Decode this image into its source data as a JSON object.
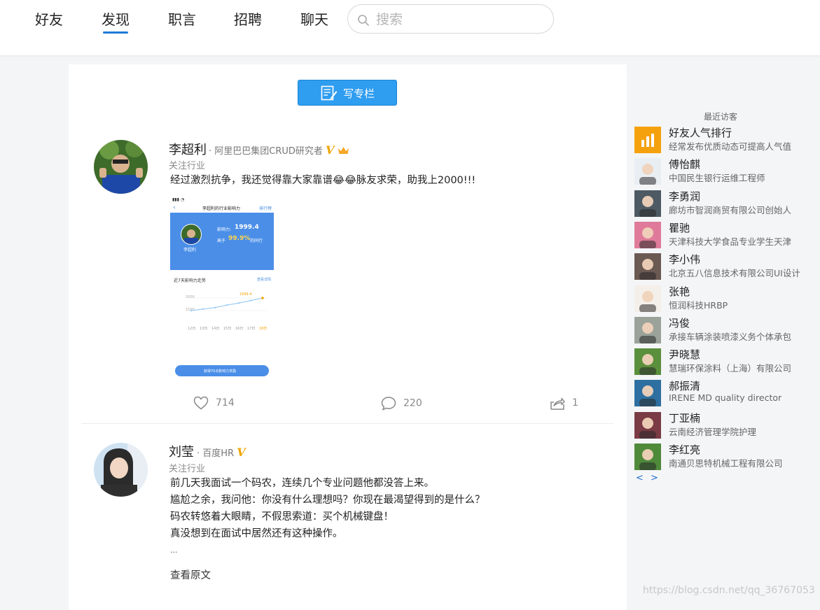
{
  "nav": {
    "items": [
      "好友",
      "发现",
      "职言",
      "招聘",
      "聊天"
    ],
    "active_index": 1,
    "accent_color": "#1e7bd7"
  },
  "search": {
    "placeholder": "搜索",
    "value": ""
  },
  "feed": {
    "write_button_label": "写专栏",
    "posts": [
      {
        "author": "李超利",
        "title": "阿里巴巴集团CRUD研究者",
        "follow_label": "关注行业",
        "text_lines": [
          "经过激烈抗争，我还觉得靠大家靠谱😂😂脉友求荣，助我上2000!!!"
        ],
        "image": {
          "header_title": "李超利的行业影响力",
          "header_link": "排行榜",
          "user_name": "李超利",
          "influence_label": "影响力:",
          "influence_value": "1999.4",
          "rank_prefix": "高于",
          "rank_value": "99.9%",
          "rank_suffix": "的同行",
          "trend_title": "近7天影响力走势",
          "trend_link": "查看详情",
          "trend_high_label": "1999.4",
          "trend_axis_top": "2000",
          "trend_axis_mid": "1500",
          "trend_days": [
            "12日",
            "13日",
            "14日",
            "15日",
            "16日",
            "17日",
            "18日"
          ],
          "trend_values": [
            1500,
            1560,
            1620,
            1720,
            1800,
            1900,
            1999.4
          ],
          "cta": "获得70点影响力奖励"
        },
        "likes": "714",
        "comments": "220",
        "shares": "1"
      },
      {
        "author": "刘莹",
        "title": "百度HR",
        "follow_label": "关注行业",
        "text_lines": [
          "前几天我面试一个码农，连续几个专业问题他都没答上来。",
          "尴尬之余，我问他：你没有什么理想吗？你现在最渴望得到的是什么？",
          "码农转悠着大眼睛，不假思索道：买个机械键盘！",
          "真没想到在面试中居然还有这种操作。",
          "..."
        ],
        "read_more": "查看原文"
      }
    ]
  },
  "sidebar": {
    "title": "最近访客",
    "visitors": [
      {
        "name": "好友人气排行",
        "desc": "经常发布优质动态可提高人气值"
      },
      {
        "name": "傅怡麒",
        "desc": "中国民生银行运维工程师"
      },
      {
        "name": "李勇润",
        "desc": "廊坊市智润商贸有限公司创始人"
      },
      {
        "name": "瞿驰",
        "desc": "天津科技大学食品专业学生天津"
      },
      {
        "name": "李小伟",
        "desc": "北京五八信息技术有限公司UI设计"
      },
      {
        "name": "张艳",
        "desc": "恒润科技HRBP"
      },
      {
        "name": "冯俊",
        "desc": "承接车辆涂装喷漆义务个体承包"
      },
      {
        "name": "尹晓慧",
        "desc": "慧瑞环保涂料（上海）有限公司"
      },
      {
        "name": "郝振清",
        "desc": "IRENE MD quality director"
      },
      {
        "name": "丁亚楠",
        "desc": "云南经济管理学院护理"
      },
      {
        "name": "李红亮",
        "desc": "南通贝思特机械工程有限公司"
      }
    ],
    "prev": "<",
    "next": ">"
  },
  "watermark": "https://blog.csdn.net/qq_36767053"
}
